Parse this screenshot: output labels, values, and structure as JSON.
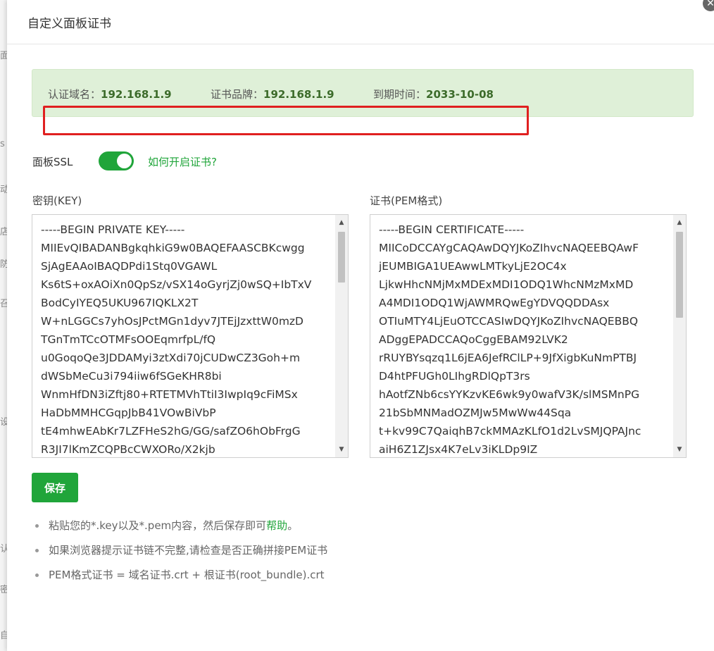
{
  "background": {
    "edge_glyphs": [
      "面",
      "s",
      "动",
      "店",
      "防",
      "召",
      "设",
      "认",
      "密",
      "自"
    ]
  },
  "dialog": {
    "title": "自定义面板证书",
    "close_icon": "close-icon"
  },
  "cert_info": {
    "domain_label": "认证域名：",
    "domain_value": "192.168.1.9",
    "brand_label": "证书品牌：",
    "brand_value": "192.168.1.9",
    "expire_label": "到期时间：",
    "expire_value": "2033-10-08"
  },
  "ssl": {
    "label": "面板SSL",
    "enabled": true,
    "help_link": "如何开启证书?"
  },
  "key_field": {
    "label": "密钥(KEY)",
    "lines": [
      "-----BEGIN PRIVATE KEY-----",
      "MIIEvQIBADANBgkqhkiG9w0BAQEFAASCBKcwgg",
      "SjAgEAAoIBAQDPdi1Stq0VGAWL",
      "Ks6tS+oxAOiXn0QpSz/vSX14oGyrjZj0wSQ+IbTxV",
      "BodCyIYEQ5UKU967IQKLX2T",
      "W+nLGGCs7yhOsJPctMGn1dyv7JTEjJzxttW0mzD",
      "TGnTmTCcOTMFsOOEqmrfpL/fQ",
      "u0GoqoQe3JDDAMyi3ztXdi70jCUDwCZ3Goh+m",
      "dWSbMeCu3i794iiw6fSGeKHR8bi",
      "WnmHfDN3iZftj80+RTETMVhTtiI3IwpIq9cFiMSx",
      "HaDbMMHCGqpJbB41VOwBiVbP",
      "tE4mhwEAbKr7LZFHeS2hG/GG/safZO6hObFrgG",
      "R3JI7lKmZCQPBcCWXORo/X2kjb"
    ]
  },
  "cert_field": {
    "label": "证书(PEM格式)",
    "lines": [
      "-----BEGIN CERTIFICATE-----",
      "MIICoDCCAYgCAQAwDQYJKoZIhvcNAQEEBQAwF",
      "jEUMBIGA1UEAwwLMTkyLjE2OC4x",
      "LjkwHhcNMjMxMDExMDI1ODQ1WhcNMzMxMD",
      "A4MDI1ODQ1WjAWMRQwEgYDVQQDDAsx",
      "OTIuMTY4LjEuOTCCASIwDQYJKoZIhvcNAQEBBQ",
      "ADggEPADCCAQoCggEBAM92LVK2",
      "rRUYBYsqzq1L6jEA6JefRClLP+9JfXigbKuNmPTBJ",
      "D4htPFUGh0LIhgRDlQpT3rs",
      "hAotfZNb6csYYKzvKE6wk9y0wafV3K/slMSMnPG",
      "21bSbMNMadOZMJw5MwWw44Sqa",
      "t+kv99C7QaiqhB7ckMMAzKLfO1d2LvSMJQPAJnc",
      "aiH6Z1ZJsx4K7eLv3iKLDp9IZ"
    ]
  },
  "actions": {
    "save_label": "保存"
  },
  "tips": {
    "tip1_text": "粘贴您的*.key以及*.pem内容，然后保存即可",
    "tip1_link": "帮助",
    "tip1_end": "。",
    "tip2": "如果浏览器提示证书链不完整,请检查是否正确拼接PEM证书",
    "tip3": "PEM格式证书 = 域名证书.crt + 根证书(root_bundle).crt"
  },
  "colors": {
    "accent": "#20a53a",
    "info_bg": "#dff0d8",
    "highlight": "#e02020"
  }
}
